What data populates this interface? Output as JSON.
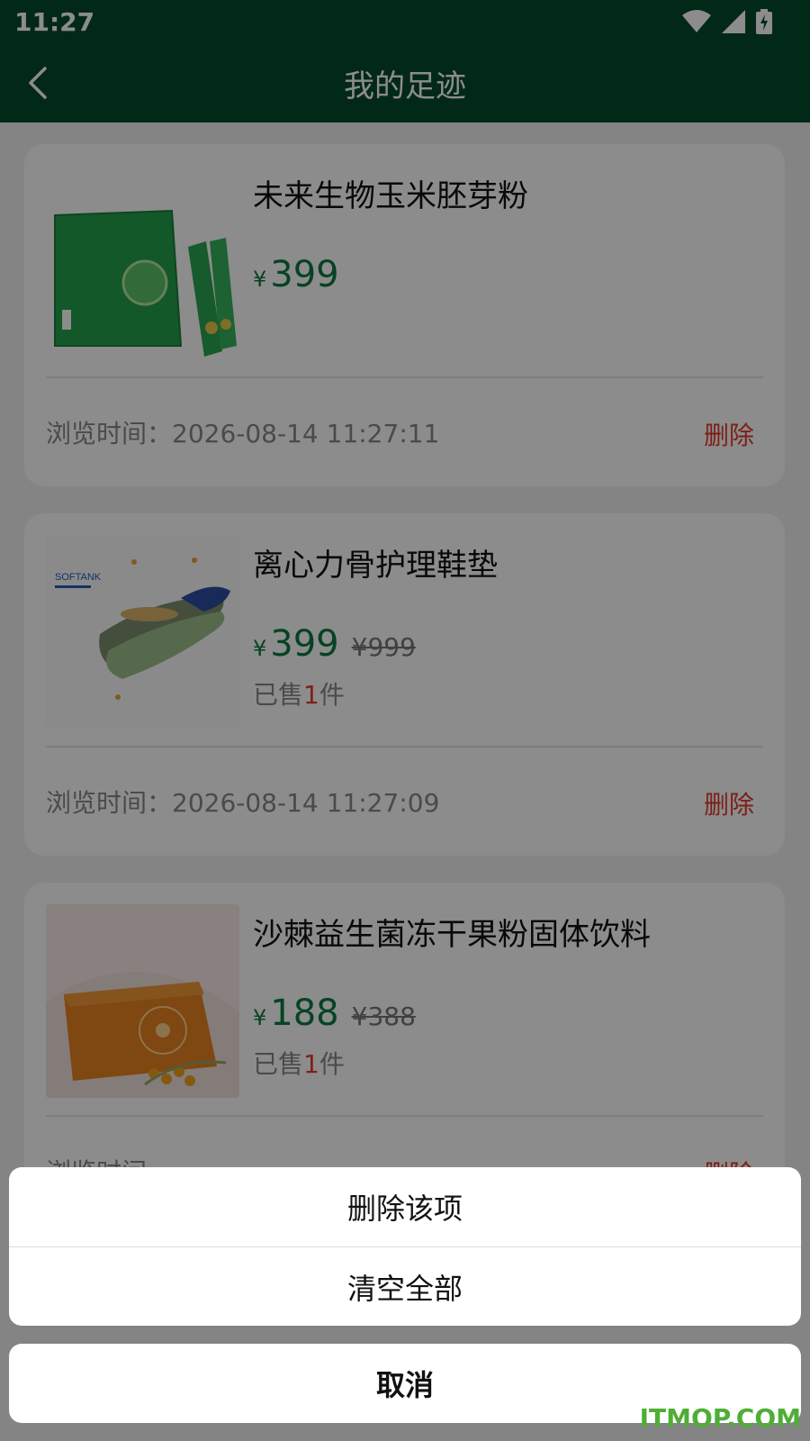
{
  "status_bar": {
    "time": "11:27"
  },
  "nav": {
    "title": "我的足迹"
  },
  "items": [
    {
      "name": "未来生物玉米胚芽粉",
      "currency": "¥",
      "price": "399",
      "original_price": "",
      "sold_prefix": "",
      "sold_count": "",
      "sold_suffix": "",
      "visit_time": "浏览时间：2026-08-14 11:27:11",
      "delete_label": "删除"
    },
    {
      "name": "离心力骨护理鞋垫",
      "currency": "¥",
      "price": "399",
      "original_price": "¥999",
      "sold_prefix": "已售",
      "sold_count": "1",
      "sold_suffix": "件",
      "visit_time": "浏览时间：2026-08-14 11:27:09",
      "delete_label": "删除"
    },
    {
      "name": "沙棘益生菌冻干果粉固体饮料",
      "currency": "¥",
      "price": "188",
      "original_price": "¥388",
      "sold_prefix": "已售",
      "sold_count": "1",
      "sold_suffix": "件",
      "visit_time": "浏览时间",
      "delete_label": "删除"
    }
  ],
  "action_sheet": {
    "options": [
      "删除该项",
      "清空全部"
    ],
    "cancel": "取消"
  },
  "watermark": "ITMOP.COM",
  "colors": {
    "header": "#054a2c",
    "price": "#0c7b40",
    "danger": "#e23b2c"
  }
}
